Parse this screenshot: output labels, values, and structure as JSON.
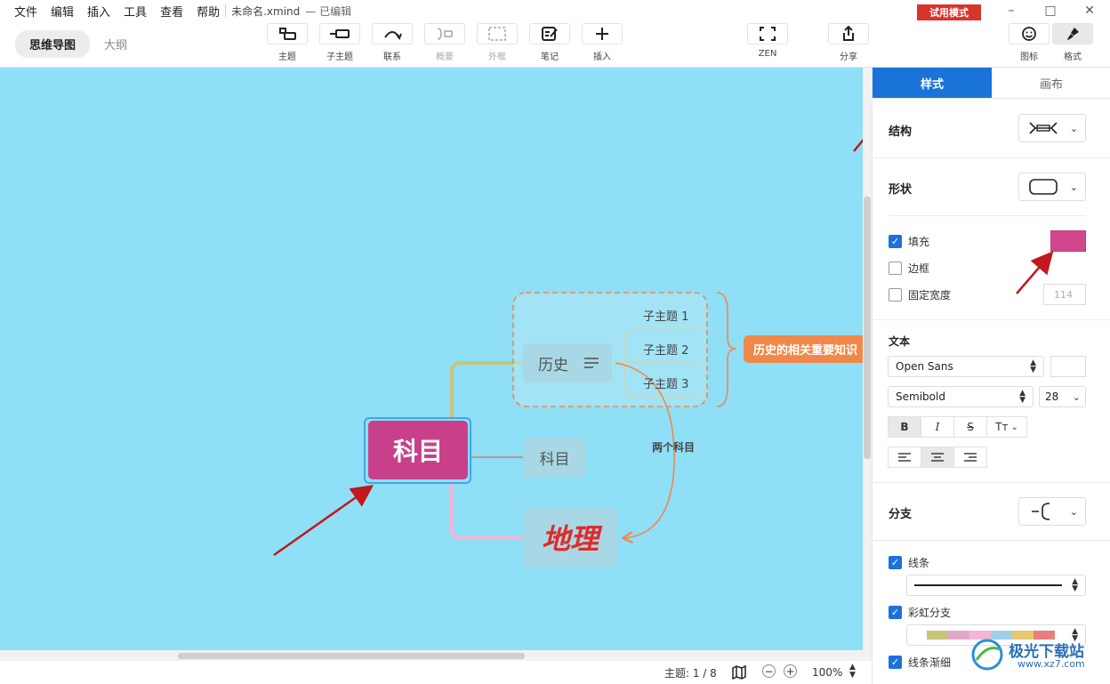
{
  "menubar": {
    "items": [
      "文件",
      "编辑",
      "插入",
      "工具",
      "查看",
      "帮助"
    ],
    "doc_title": "未命名.xmind",
    "doc_status": "— 已编辑",
    "trial_badge": "试用模式"
  },
  "window_controls": {
    "minimize": "–",
    "maximize": "□",
    "close": "✕"
  },
  "view_toggle": {
    "active": "思维导图",
    "inactive": "大纲"
  },
  "toolbar": {
    "topic": "主题",
    "subtopic": "子主题",
    "relationship": "联系",
    "summary": "概要",
    "boundary": "外框",
    "notes": "笔记",
    "insert": "插入",
    "zen": "ZEN",
    "share": "分享",
    "icons": "图标",
    "format": "格式"
  },
  "mindmap": {
    "central": "科目",
    "branches": [
      "历史",
      "科目",
      "地理"
    ],
    "subtopics": [
      "子主题 1",
      "子主题 2",
      "子主题 3"
    ],
    "summary": "历史的相关重要知识",
    "relationship_label": "两个科目",
    "colors": {
      "canvas": "#8fdff7",
      "central": "#c9408a",
      "summary": "#f0884a",
      "relationship": "#f0884a",
      "geo_text": "#e02a2a"
    }
  },
  "statusbar": {
    "topic_count": "主题: 1 / 8",
    "zoom": "100%",
    "zoom_minus": "−",
    "zoom_plus": "+"
  },
  "panel": {
    "tabs": [
      "样式",
      "画布"
    ],
    "structure": "结构",
    "shape": "形状",
    "fill": {
      "label": "填充",
      "checked": true,
      "color": "#d2478c"
    },
    "border": {
      "label": "边框",
      "checked": false
    },
    "fixed_width": {
      "label": "固定宽度",
      "checked": false,
      "value": "114"
    },
    "text": {
      "title": "文本",
      "font": "Open Sans",
      "weight": "Semibold",
      "size": "28",
      "bold": "B",
      "italic": "I",
      "strike": "S",
      "case": "Tт"
    },
    "branch": "分支",
    "line": {
      "label": "线条",
      "checked": true
    },
    "rainbow": {
      "label": "彩虹分支",
      "checked": true,
      "colors": [
        "#c9c47b",
        "#e0a8c8",
        "#f4b6d4",
        "#9fd0e8",
        "#e8c86f",
        "#e87f7f"
      ]
    },
    "taper": {
      "label": "线条渐细",
      "checked": true
    }
  },
  "watermark": {
    "text": "极光下载站",
    "url": "www.xz7.com"
  }
}
